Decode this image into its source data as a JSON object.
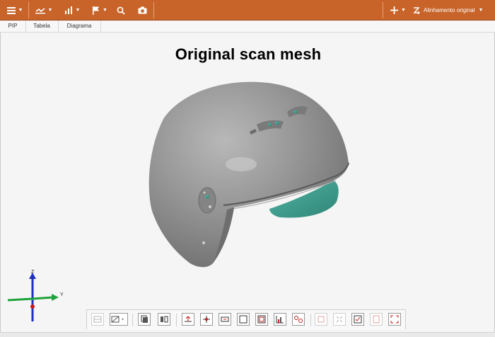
{
  "toolbar": {
    "alignment_label": "Alinhamento original",
    "colors": {
      "bar": "#c8642a"
    }
  },
  "tabs": [
    {
      "label": "PIP"
    },
    {
      "label": "Tabela"
    },
    {
      "label": "Diagrama"
    }
  ],
  "viewport": {
    "title": "Original scan mesh",
    "mesh_colors": {
      "shell": "#8e8e8e",
      "visor": "#3f9d8e"
    }
  },
  "axes": {
    "z": "Z",
    "y": "Y"
  },
  "icons": {
    "top": [
      "menu-icon",
      "measure-icon",
      "chart-icon",
      "flag-icon",
      "zoom-icon",
      "camera-icon",
      "plus-icon",
      "alignment-icon"
    ],
    "bottom": [
      "grid-icon",
      "view-mode-icon",
      "copy-icon",
      "compare-icon",
      "align-icon",
      "section-icon",
      "dimension-icon",
      "square-icon",
      "frame-icon",
      "histogram-icon",
      "points-icon",
      "fit-icon",
      "shrink-icon",
      "check-icon",
      "note-icon",
      "expand-icon"
    ]
  }
}
